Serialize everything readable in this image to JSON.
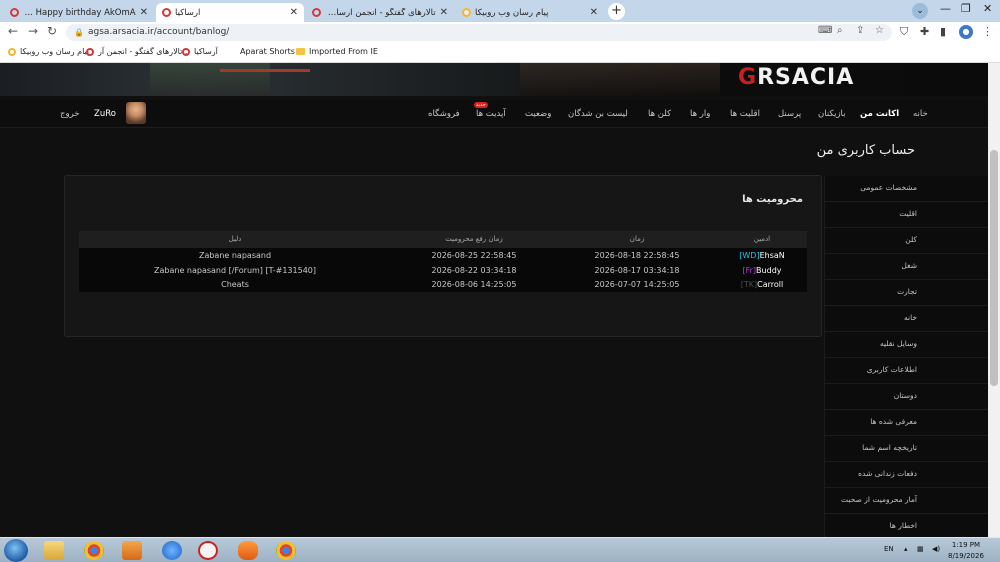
{
  "browser": {
    "tabs": [
      {
        "title": "Happy birthday AkOmA - آرسـاکیا گیم",
        "icon": "arsacia-icon"
      },
      {
        "title": "آرساکیا",
        "icon": "arsacia-icon"
      },
      {
        "title": "تالارهای گفتگو - انجمن آرساکیا گیم",
        "icon": "arsacia-icon"
      },
      {
        "title": "پیام رسان وب روبیکا",
        "icon": "rubika-icon"
      }
    ],
    "url": "agsa.arsacia.ir/account/banlog/",
    "bookmarks": [
      {
        "label": "پیام رسان وب روبیکا",
        "icon": "rubika-icon"
      },
      {
        "label": "تالارهای گفتگو - انجمن آر...",
        "icon": "arsacia-icon"
      },
      {
        "label": "آرساکیا",
        "icon": "arsacia-icon"
      },
      {
        "label": "Aparat Shorts",
        "icon": "page-icon"
      },
      {
        "label": "Imported From IE",
        "icon": "folder-icon"
      }
    ]
  },
  "site": {
    "logo_text": "RSACIA",
    "nav": {
      "home": "خانه",
      "my_account": "اکانت من",
      "players": "بازیکنان",
      "personnel": "پرسنل",
      "minorities": "اقلیت ها",
      "wars": "وار ها",
      "clans": "کلن ها",
      "banned_list": "لیست بن شدگان",
      "status": "وضعیت",
      "updates": "آپدیت ها",
      "updates_badge": "جدید",
      "shop": "فروشگاه",
      "username": "ZuRo",
      "logout": "خروج"
    },
    "page_title": "حساب کاربری من"
  },
  "banlog": {
    "title": "محرومیت ها",
    "columns": {
      "admin": "ادمین",
      "time": "زمان",
      "unban_time": "زمان رفع محرومیت",
      "reason": "دلیل"
    },
    "rows": [
      {
        "tag": "[WD]",
        "name": "EhsaN",
        "time": "2026-08-18 22:58:45",
        "unban_time": "2026-08-25 22:58:45",
        "reason": "Zabane napasand"
      },
      {
        "tag": "[Fr]",
        "name": "Buddy",
        "time": "2026-08-17 03:34:18",
        "unban_time": "2026-08-22 03:34:18",
        "reason": "Zabane napasand [/Forum] [T-#131540]"
      },
      {
        "tag": "[TK]",
        "name": "Carroll",
        "time": "2026-07-07 14:25:05",
        "unban_time": "2026-08-06 14:25:05",
        "reason": "Cheats"
      }
    ]
  },
  "sidebar": {
    "items": [
      "مشخصات عمومی",
      "اقلیت",
      "کلن",
      "شغل",
      "تجارت",
      "خانه",
      "وسایل نقلیه",
      "اطلاعات کاربری",
      "دوستان",
      "معرفی شده ها",
      "تاریخچه اسم شما",
      "دفعات زندانی شده",
      "آمار محرومیت از صحبت",
      "اخطار ها"
    ]
  },
  "taskbar": {
    "language": "EN",
    "time": "1:19 PM",
    "date": "8/19/2026"
  }
}
